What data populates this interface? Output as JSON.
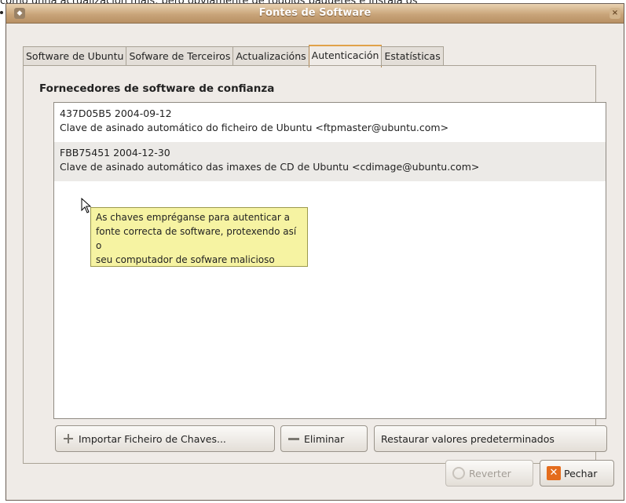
{
  "page_top_text": "como unha actualización máis, pero obviamente de todolos paquetes e instala os",
  "window": {
    "title": "Fontes de Software",
    "close_glyph": "×"
  },
  "tabs": [
    {
      "label": "Software de Ubuntu"
    },
    {
      "label": "Sofware de Terceiros"
    },
    {
      "label": "Actualizacións"
    },
    {
      "label": "Autenticación"
    },
    {
      "label": "Estatísticas"
    }
  ],
  "section_title": "Fornecedores de software de confianza",
  "keys": [
    {
      "id_date": "437D05B5 2004-09-12",
      "description": "Clave de asinado automático do ficheiro de Ubuntu <ftpmaster@ubuntu.com>"
    },
    {
      "id_date": "FBB75451 2004-12-30",
      "description": "Clave de asinado automático das imaxes de CD de Ubuntu <cdimage@ubuntu.com>"
    }
  ],
  "tooltip": {
    "lines": [
      "As chaves empréganse para autenticar a",
      "fonte correcta de software, protexendo así o",
      "seu computador de sofware malicioso"
    ]
  },
  "buttons": {
    "import_label": "Importar Ficheiro de Chaves...",
    "remove_label": "Eliminar",
    "restore_label": "Restaurar valores predeterminados",
    "revert_label": "Reverter",
    "close_label": "Pechar"
  },
  "colors": {
    "titlebar": "#c9a57a",
    "tooltip_bg": "#f6f3a2",
    "close_icon": "#e46c1c"
  }
}
